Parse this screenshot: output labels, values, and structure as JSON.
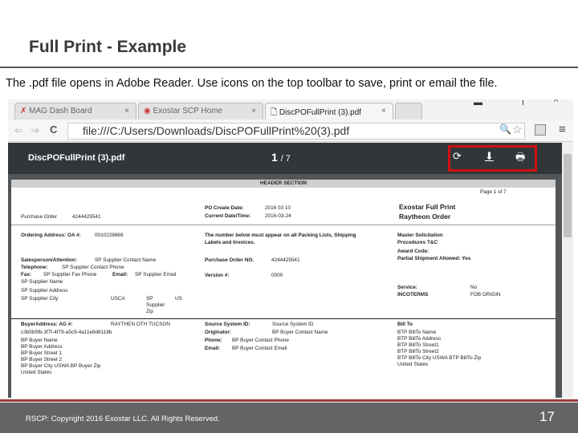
{
  "slide": {
    "title": "Full Print - Example",
    "caption": "The .pdf file opens in Adobe Reader.  Use icons on the top toolbar to save, print or email the file.",
    "copyright": "RSCP:  Copyright 2016 Exostar LLC. All Rights Reserved.",
    "slide_number": "17"
  },
  "browser": {
    "tabs": [
      {
        "label": "MAG Dash Board"
      },
      {
        "label": "Exostar SCP Home"
      },
      {
        "label": "DiscPOFullPrint (3).pdf"
      }
    ],
    "url": "file:///C:/Users/Downloads/DiscPOFullPrint%20(3).pdf"
  },
  "pdf": {
    "filename": "DiscPOFullPrint (3).pdf",
    "current_page": "1",
    "page_total": "/ 7",
    "highlight_color": "#d01010"
  },
  "document": {
    "header_section": "HEADER SECTION",
    "page_of": "Page 1 of  7",
    "po_label": "Purchase Order",
    "po_value": "4244425541",
    "create_date_label": "PO Create Date:",
    "create_date": "2016 03 10",
    "current_dt_label": "Current Date/Time:",
    "current_dt": "2016-03-24",
    "title1": "Exostar Full Print",
    "title2": "Raytheon Order",
    "ordering_label": "Ordering Address: OA #:",
    "ordering_value": "0010228869",
    "notice1": "The number below must appear on all Packing Lists, Shipping",
    "notice2": "Labels and Invoices.",
    "master1": "Master Solicitation",
    "master2": "Procedures T&C",
    "award": "Award Code:",
    "partial": "Partial Shipment Allowed: Yes",
    "sales_label": "Salesperson/Attention:",
    "sales_value": "SP Supplier Contact Name",
    "tel_label": "Telephone:",
    "tel_value": "SP Supplier Contact Phone",
    "fax_label": "Fax:",
    "fax_value": "SP Supplier Fax Phone",
    "email_label": "Email:",
    "email_value": "SP Supplier Email",
    "sup_name": "SP Supplier Name",
    "sup_addr": "SP Supplier Address",
    "sup_city": "SP Supplier City",
    "sup_state": "USCA",
    "sup_zip1": "SP",
    "sup_zip2": "Supplier",
    "sup_zip3": "Zip",
    "sup_country": "US",
    "pono_label": "Purchase Order NO.",
    "pono_value": "4244425541",
    "version_label": "Version #:",
    "version_value": "0000",
    "service_label": "Service:",
    "service_value": "No",
    "incoterms_label": "INCOTERMS",
    "incoterms_value": "FOB ORIGIN",
    "buyer_label": "BuyerAddress:  AG #:",
    "buyer_ag": "RAYTHEN OTH TUCSON",
    "buyer_id": "c3b5b5fb-3f7f-4f79-a5c9-4a11e8d6118b",
    "buyer_lines": [
      "BP Buyer Name",
      "BP Buyer Address",
      "BP Buyer Street 1",
      "BP Buyer Street 2",
      "BP Buyer City USWA BP Buyer Zip",
      "United States"
    ],
    "src_label": "Source System ID:",
    "src_value": "Source System ID",
    "orig_label": "Originator:",
    "orig_value": "BP Buyer Contact Name",
    "phone_label": "Phone:",
    "phone_value": "BP Buyer Contact Phone",
    "bemail_label": "Email:",
    "bemail_value": "BP Buyer Contact Email",
    "billto_label": "Bill To",
    "billto_lines": [
      "BTP BillTo Name",
      "BTP BillTo Address",
      "BTP BillTo Street1",
      "BTP BillTo Street2",
      "BTP BillTo City USWA BTP BillTo Zip",
      "United States"
    ]
  }
}
